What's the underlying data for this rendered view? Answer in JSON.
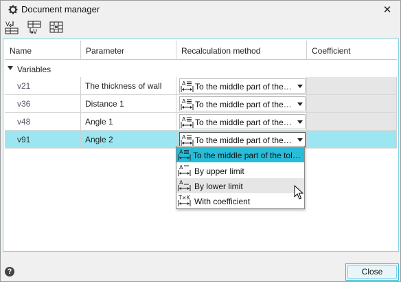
{
  "window": {
    "title": "Document manager"
  },
  "toolbar": {
    "icons": [
      "recalculate-down-icon",
      "recalculate-list-icon",
      "table-delete-icon"
    ]
  },
  "table": {
    "headers": [
      "Name",
      "Parameter",
      "Recalculation method",
      "Coefficient"
    ],
    "group": "Variables",
    "rows": [
      {
        "name": "v21",
        "parameter": "The thickness of wall",
        "method": "To the middle part of the tolerance",
        "coefficient": ""
      },
      {
        "name": "v36",
        "parameter": "Distance 1",
        "method": "To the middle part of the tolerance",
        "coefficient": ""
      },
      {
        "name": "v48",
        "parameter": "Angle 1",
        "method": "To the middle part of the tolerance",
        "coefficient": ""
      },
      {
        "name": "v91",
        "parameter": "Angle 2",
        "method": "To the middle part of the tolerance",
        "coefficient": ""
      }
    ],
    "selected_row": 3
  },
  "dropdown": {
    "options": [
      {
        "label": "To the middle part of the tolerance",
        "icon": "middle-tolerance-icon",
        "state": "selected"
      },
      {
        "label": "By upper limit",
        "icon": "upper-limit-icon",
        "state": "normal"
      },
      {
        "label": "By lower limit",
        "icon": "lower-limit-icon",
        "state": "hover"
      },
      {
        "label": "With coefficient",
        "icon": "coefficient-icon",
        "state": "normal"
      }
    ]
  },
  "footer": {
    "help_label": "?",
    "close_label": "Close"
  },
  "colors": {
    "accent": "#27bcd8",
    "selected_row": "#9be6f0",
    "panel_border": "#7fd4e6"
  }
}
